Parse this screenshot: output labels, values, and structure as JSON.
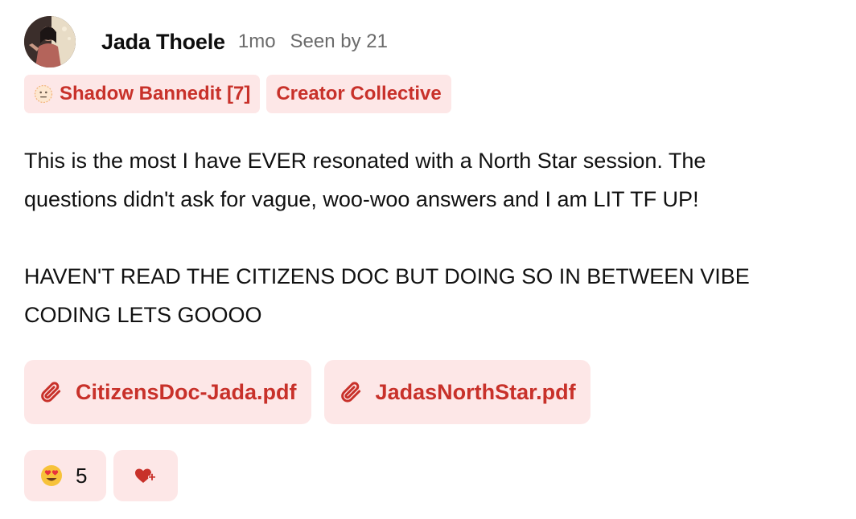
{
  "author": {
    "name": "Jada Thoele",
    "time": "1mo",
    "seen": "Seen by 21"
  },
  "tags": [
    {
      "label": "Shadow Bannedit [7]",
      "icon": "neutral-face-icon"
    },
    {
      "label": "Creator Collective"
    }
  ],
  "body": {
    "paragraph1_line1": "This is the most I have EVER resonated with a North Star session. The",
    "paragraph1_line2": "questions didn't ask for vague, woo-woo answers and I am LIT TF UP!",
    "paragraph2_line1": "HAVEN'T READ THE CITIZENS DOC BUT DOING SO IN BETWEEN VIBE",
    "paragraph2_line2": "CODING LETS GOOOO"
  },
  "attachments": [
    {
      "name": "CitizensDoc-Jada.pdf",
      "icon": "paperclip-icon"
    },
    {
      "name": "JadasNorthStar.pdf",
      "icon": "paperclip-icon"
    }
  ],
  "reactions": [
    {
      "emoji": "heart-eyes-emoji",
      "count": "5"
    }
  ],
  "add_reaction_icon": "heart-plus-icon",
  "colors": {
    "accent": "#c8312a",
    "chip_bg": "#fde7e7",
    "muted": "#6b6b6b"
  }
}
